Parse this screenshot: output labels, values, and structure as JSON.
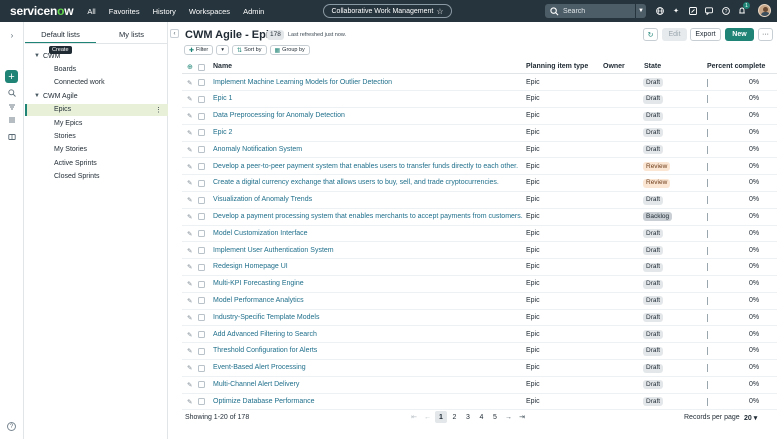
{
  "topnav": {
    "logo_prefix": "servicen",
    "logo_o": "o",
    "logo_suffix": "w",
    "links": [
      "All",
      "Favorites",
      "History",
      "Workspaces",
      "Admin"
    ],
    "workspace": "Collaborative Work Management",
    "search_placeholder": "Search",
    "notification_count": "1",
    "icons": [
      "globe-icon",
      "sparkle-icon",
      "link-icon",
      "chat-icon",
      "help-icon",
      "bell-icon"
    ]
  },
  "lists_panel": {
    "tabs": [
      "Default lists",
      "My lists"
    ],
    "tooltip": "Create",
    "groups": [
      {
        "label": "CWM",
        "items": [
          "Boards",
          "Connected work"
        ]
      },
      {
        "label": "CWM Agile",
        "items": [
          "Epics",
          "My Epics",
          "Stories",
          "My Stories",
          "Active Sprints",
          "Closed Sprints"
        ]
      }
    ],
    "selected": "Epics"
  },
  "main": {
    "title": "CWM Agile - Epics",
    "count": "178",
    "refreshed": "Last refreshed just now.",
    "chips": {
      "filter": "Filter",
      "sort": "Sort by",
      "group": "Group by"
    },
    "buttons": {
      "edit": "Edit",
      "export": "Export",
      "new": "New",
      "more": "···"
    },
    "columns": {
      "name": "Name",
      "type": "Planning item type",
      "owner": "Owner",
      "state": "State",
      "percent": "Percent complete"
    },
    "rows": [
      {
        "name": "Implement Machine Learning Models for Outlier Detection",
        "type": "Epic",
        "state": "Draft",
        "percent": "0%"
      },
      {
        "name": "Epic 1",
        "type": "Epic",
        "state": "Draft",
        "percent": "0%"
      },
      {
        "name": "Data Preprocessing for Anomaly Detection",
        "type": "Epic",
        "state": "Draft",
        "percent": "0%"
      },
      {
        "name": "Epic 2",
        "type": "Epic",
        "state": "Draft",
        "percent": "0%"
      },
      {
        "name": "Anomaly Notification System",
        "type": "Epic",
        "state": "Draft",
        "percent": "0%"
      },
      {
        "name": "Develop a peer-to-peer payment system that enables users to transfer funds directly to each other.",
        "type": "Epic",
        "state": "Review",
        "percent": "0%"
      },
      {
        "name": "Create a digital currency exchange that allows users to buy, sell, and trade cryptocurrencies.",
        "type": "Epic",
        "state": "Review",
        "percent": "0%"
      },
      {
        "name": "Visualization of Anomaly Trends",
        "type": "Epic",
        "state": "Draft",
        "percent": "0%"
      },
      {
        "name": "Develop a payment processing system that enables merchants to accept payments from customers.",
        "type": "Epic",
        "state": "Backlog",
        "percent": "0%"
      },
      {
        "name": "Model Customization Interface",
        "type": "Epic",
        "state": "Draft",
        "percent": "0%"
      },
      {
        "name": "Implement User Authentication System",
        "type": "Epic",
        "state": "Draft",
        "percent": "0%"
      },
      {
        "name": "Redesign Homepage UI",
        "type": "Epic",
        "state": "Draft",
        "percent": "0%"
      },
      {
        "name": "Multi-KPI Forecasting Engine",
        "type": "Epic",
        "state": "Draft",
        "percent": "0%"
      },
      {
        "name": "Model Performance Analytics",
        "type": "Epic",
        "state": "Draft",
        "percent": "0%"
      },
      {
        "name": "Industry-Specific Template Models",
        "type": "Epic",
        "state": "Draft",
        "percent": "0%"
      },
      {
        "name": "Add Advanced Filtering to Search",
        "type": "Epic",
        "state": "Draft",
        "percent": "0%"
      },
      {
        "name": "Threshold Configuration for Alerts",
        "type": "Epic",
        "state": "Draft",
        "percent": "0%"
      },
      {
        "name": "Event-Based Alert Processing",
        "type": "Epic",
        "state": "Draft",
        "percent": "0%"
      },
      {
        "name": "Multi-Channel Alert Delivery",
        "type": "Epic",
        "state": "Draft",
        "percent": "0%"
      },
      {
        "name": "Optimize Database Performance",
        "type": "Epic",
        "state": "Draft",
        "percent": "0%"
      }
    ],
    "footer": {
      "showing": "Showing 1-20 of 178",
      "pages": [
        "1",
        "2",
        "3",
        "4",
        "5"
      ],
      "current_page": "1",
      "records_label": "Records per page",
      "records_value": "20 ▾"
    }
  }
}
